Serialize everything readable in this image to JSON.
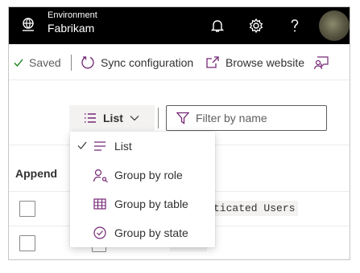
{
  "header": {
    "environment_label": "Environment",
    "environment_name": "Fabrikam",
    "icons": [
      "environment-icon",
      "bell-icon",
      "gear-icon",
      "help-icon"
    ]
  },
  "commandbar": {
    "saved_label": "Saved",
    "sync_label": "Sync configuration",
    "browse_label": "Browse website"
  },
  "toolbar": {
    "view_label": "List",
    "filter_placeholder": "Filter by name"
  },
  "grid": {
    "column_header": "Append",
    "cell_text": "ticated Users"
  },
  "menu": {
    "items": [
      {
        "label": "List",
        "icon": "list-icon",
        "selected": true
      },
      {
        "label": "Group by role",
        "icon": "role-icon",
        "selected": false
      },
      {
        "label": "Group by table",
        "icon": "table-icon",
        "selected": false
      },
      {
        "label": "Group by state",
        "icon": "state-check-icon",
        "selected": false
      }
    ]
  },
  "colors": {
    "header_bg": "#000000",
    "accent": "#742774",
    "text": "#323130"
  }
}
